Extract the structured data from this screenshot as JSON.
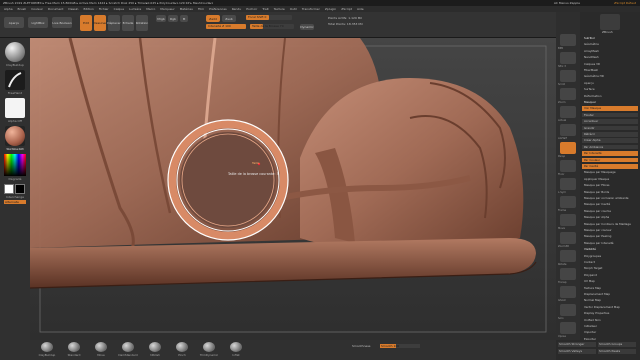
{
  "titlebar": {
    "left": "ZBrush 2019   ZLETORMEX   ▸ Free Mem 15.800GB ▸ Active Mem 1424 ▸ Scratch Disk 250 ▸ Timer▸0.025 ▸ PolyCount▸1.129 KP ▸ MeshCount▸1",
    "center": "AC   Menus  Zapple",
    "right": "ZScript Défaut"
  },
  "menubar": [
    "Alpha",
    "Brush",
    "Couleur",
    "Document",
    "Dessin",
    "Edition",
    "Fichier",
    "Calque",
    "Lumière",
    "Macro",
    "Marqueur",
    "Matériau",
    "Film",
    "Préférences",
    "Rendu",
    "Pochoir",
    "Trait",
    "Texture",
    "Outil",
    "Transformer",
    "Zplugin",
    "ZScript",
    "Aide"
  ],
  "topbar": {
    "btn1": "Aperçu",
    "btn2": "LightBox",
    "btn3": "Live Boolean",
    "edit": "Edit",
    "draw": "Dessiner",
    "move": "Déplacer",
    "scale": "Echelle",
    "rotate": "Rotation",
    "mrgb": "Mrgb",
    "rgb": "Rgb",
    "m": "M",
    "zadd": "Zadd",
    "zsub": "Zsub",
    "focal_label": "Focal Shift 0",
    "z_intensity": "Intensité Z 100",
    "draw_size": "Taille de la Brosse 70",
    "dynamic": "Dynamic",
    "active_points": "Points Actifs: 1.129 Mil",
    "total_points": "Total Points: 18.353 Mil"
  },
  "breadcrumb": "▸ 1.129 5 67 / 1.129",
  "left_shelf": {
    "brush_label": "ClayBuildup",
    "stroke_label": "FreeHand",
    "alpha_label": "Alpha Off",
    "texture_label": "Texture Off",
    "material_label": "SkinShade4",
    "gradient_label": "Dégradé",
    "swatch_label": "Interchange",
    "alt_label": "Alternate"
  },
  "viewport": {
    "tooltip": "Taille de la brosse courante: 5",
    "mini_tip": "Taille"
  },
  "right_shelf": [
    "BPR",
    "SPix 3",
    "Scroll",
    "Zoom",
    "Actual",
    "AAHalf",
    "Persp",
    "Floor",
    "L.Sym",
    "Frame",
    "Move",
    "Zoom3D",
    "Rotate",
    "Transp",
    "Ghost",
    "Solo",
    "Xpose"
  ],
  "right_panel": {
    "user": "ZBrush",
    "items": [
      {
        "label": "SubTool",
        "style": "hd"
      },
      {
        "label": "Géométrie",
        "style": ""
      },
      {
        "label": "ArrayMesh",
        "style": ""
      },
      {
        "label": "NanoMesh",
        "style": ""
      },
      {
        "label": "Calques 3D",
        "style": ""
      },
      {
        "label": "FiberMesh",
        "style": ""
      },
      {
        "label": "Géométrie HD",
        "style": ""
      },
      {
        "label": "Aperçu",
        "style": ""
      },
      {
        "label": "Surface",
        "style": ""
      },
      {
        "label": "Déformation",
        "style": ""
      },
      {
        "label": "Masquer",
        "style": "hd"
      },
      {
        "label": "Voir Masque",
        "style": "hl"
      },
      {
        "label": "Flouter",
        "style": "sub"
      },
      {
        "label": "Accentuer",
        "style": "sub"
      },
      {
        "label": "Grandir",
        "style": "sub"
      },
      {
        "label": "Rétrécir",
        "style": "sub"
      },
      {
        "label": "Créer Alpha",
        "style": "sub"
      },
      {
        "label": "Par Ambiance",
        "style": "sub"
      },
      {
        "label": "Par Intensité",
        "style": "hl"
      },
      {
        "label": "Par Couleur",
        "style": "hl"
      },
      {
        "label": "Par Cavité",
        "style": "hl"
      },
      {
        "label": "Masque par Masquage",
        "style": ""
      },
      {
        "label": "Appliquer Masque",
        "style": ""
      },
      {
        "label": "Masque par Fibres",
        "style": ""
      },
      {
        "label": "Masque par Bords",
        "style": ""
      },
      {
        "label": "Masque par occlusion ambiante",
        "style": ""
      },
      {
        "label": "Masque par Cavité",
        "style": ""
      },
      {
        "label": "Masque par courbe",
        "style": ""
      },
      {
        "label": "Masque par Alpha",
        "style": ""
      },
      {
        "label": "Masque par Contours de Maillage",
        "style": ""
      },
      {
        "label": "Masque par couleur",
        "style": ""
      },
      {
        "label": "Masque par Peeling",
        "style": ""
      },
      {
        "label": "Masque par Intensité",
        "style": ""
      },
      {
        "label": "Visibilité",
        "style": "hd"
      },
      {
        "label": "Polygroupes",
        "style": ""
      },
      {
        "label": "Contact",
        "style": ""
      },
      {
        "label": "Morph Target",
        "style": ""
      },
      {
        "label": "Polypaint",
        "style": ""
      },
      {
        "label": "UV Map",
        "style": ""
      },
      {
        "label": "Texture Map",
        "style": ""
      },
      {
        "label": "Displacement Map",
        "style": ""
      },
      {
        "label": "Normal Map",
        "style": ""
      },
      {
        "label": "Vector Displacement Map",
        "style": ""
      },
      {
        "label": "Display Properties",
        "style": ""
      },
      {
        "label": "Unified Skin",
        "style": ""
      },
      {
        "label": "Initialiser",
        "style": ""
      },
      {
        "label": "Importer",
        "style": ""
      },
      {
        "label": "Exporter",
        "style": ""
      }
    ]
  },
  "bottom_bar": {
    "brushes": [
      "ClayBuildup",
      "Standard",
      "Move",
      "DamStandard",
      "hPolish",
      "Pinch",
      "TrimDynamic",
      "Inflat"
    ],
    "smooth_label": "Smoothness",
    "smooth_value": "Smooth 100",
    "right_labels": [
      "Smooth Stronger",
      "Smooth Groups",
      "Smooth Valleys",
      "Smooth Peaks"
    ]
  },
  "colors": {
    "accent": "#d87b2c",
    "model": "#a8735e",
    "background": "#3a3a3a"
  }
}
